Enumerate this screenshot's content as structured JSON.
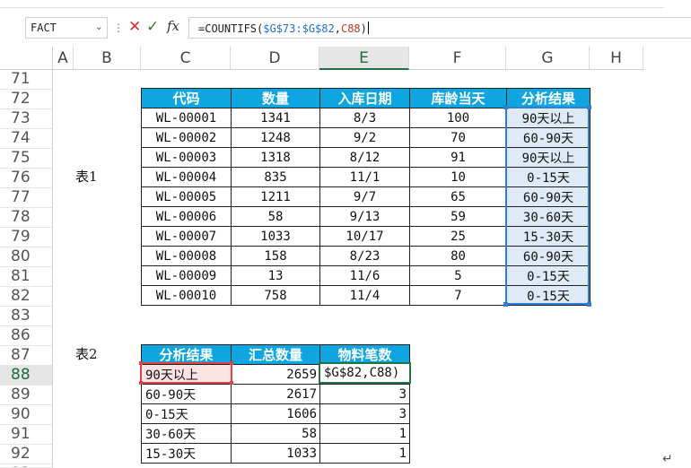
{
  "namebox": {
    "value": "FACT"
  },
  "formula_bar": {
    "prefix": "=COUNTIFS(",
    "ref1": "$G$73:$G$82",
    "comma": ",",
    "ref2": "C88",
    "suffix": ")"
  },
  "columns": [
    "A",
    "B",
    "C",
    "D",
    "E",
    "F",
    "G",
    "H"
  ],
  "rows": [
    "71",
    "72",
    "73",
    "74",
    "75",
    "76",
    "77",
    "78",
    "79",
    "80",
    "81",
    "82",
    "83",
    "86",
    "87",
    "88",
    "89",
    "90",
    "91",
    "92",
    "93"
  ],
  "label1": "表1",
  "label2": "表2",
  "table1": {
    "headers": [
      "代码",
      "数量",
      "入库日期",
      "库龄当天",
      "分析结果"
    ],
    "rows": [
      [
        "WL-00001",
        "1341",
        "8/3",
        "100",
        "90天以上"
      ],
      [
        "WL-00002",
        "1248",
        "9/2",
        "70",
        "60-90天"
      ],
      [
        "WL-00003",
        "1318",
        "8/12",
        "91",
        "90天以上"
      ],
      [
        "WL-00004",
        "835",
        "11/1",
        "10",
        "0-15天"
      ],
      [
        "WL-00005",
        "1211",
        "9/7",
        "65",
        "60-90天"
      ],
      [
        "WL-00006",
        "58",
        "9/13",
        "59",
        "30-60天"
      ],
      [
        "WL-00007",
        "1033",
        "10/17",
        "25",
        "15-30天"
      ],
      [
        "WL-00008",
        "158",
        "8/23",
        "80",
        "60-90天"
      ],
      [
        "WL-00009",
        "13",
        "11/6",
        "5",
        "0-15天"
      ],
      [
        "WL-00010",
        "758",
        "11/4",
        "7",
        "0-15天"
      ]
    ]
  },
  "table2": {
    "headers": [
      "分析结果",
      "汇总数量",
      "物料笔数"
    ],
    "rows": [
      [
        "90天以上",
        "2659",
        "$G$82,C88)"
      ],
      [
        "60-90天",
        "2617",
        "3"
      ],
      [
        "0-15天",
        "1606",
        "3"
      ],
      [
        "30-60天",
        "58",
        "1"
      ],
      [
        "15-30天",
        "1033",
        "1"
      ]
    ]
  },
  "colors": {
    "header_bg": "#0ea5e0",
    "selection_blue": "#2f7fd5",
    "ref_red": "#d44444",
    "active_green": "#217346"
  }
}
